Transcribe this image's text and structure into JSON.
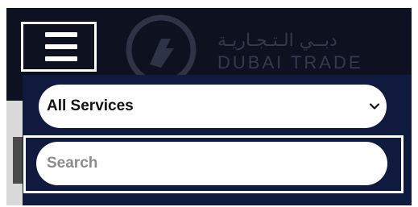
{
  "header": {
    "logo_arabic": "دبــي الـتـجـاريـة",
    "logo_latin": "DUBAI TRADE",
    "logo_icon": "dubai-trade-logo-icon"
  },
  "menu": {
    "hamburger_icon": "hamburger-menu-icon",
    "services_select": {
      "selected_label": "All Services",
      "chevron_icon": "chevron-down-icon"
    },
    "search": {
      "placeholder": "Search",
      "value": ""
    }
  },
  "colors": {
    "header_bg": "#0d1120",
    "panel_bg": "#101a3f",
    "highlight_border": "#ffffff"
  }
}
